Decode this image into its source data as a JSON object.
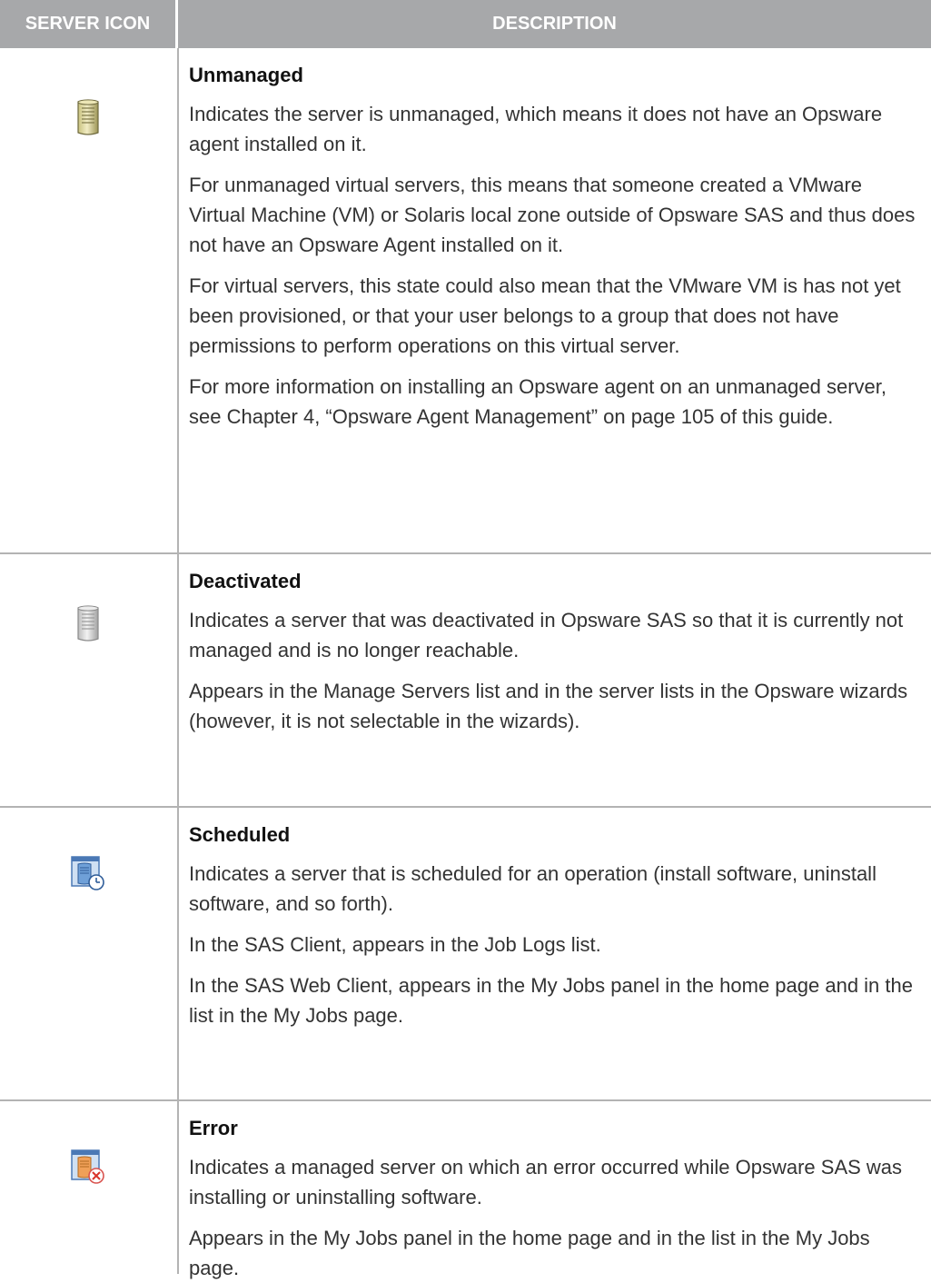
{
  "header": {
    "icon_col": "SERVER ICON",
    "desc_col": "DESCRIPTION"
  },
  "rows": [
    {
      "icon": "server-unmanaged-icon",
      "title": "Unmanaged",
      "paragraphs": [
        "Indicates the server is unmanaged, which means it does not have an Opsware agent installed on it.",
        "For unmanaged virtual servers, this means that someone created a VMware Virtual Machine (VM) or Solaris local zone outside of Opsware SAS and thus does not have an Opsware Agent installed on it.",
        "For virtual servers, this state could also mean that the VMware VM is has not yet been provisioned, or that your user belongs to a group that does not have permissions to perform operations on this virtual server.",
        "For more information on installing an Opsware agent on an unmanaged server, see Chapter 4, “Opsware Agent Management” on page 105 of this guide."
      ]
    },
    {
      "icon": "server-deactivated-icon",
      "title": "Deactivated",
      "paragraphs": [
        "Indicates a server that was deactivated in Opsware SAS so that it is currently not managed and is no longer reachable.",
        "Appears in the Manage Servers list and in the server lists in the Opsware wizards (however, it is not selectable in the wizards)."
      ]
    },
    {
      "icon": "server-scheduled-icon",
      "title": "Scheduled",
      "paragraphs": [
        "Indicates a server that is scheduled for an operation (install software, uninstall software, and so forth).",
        "In the SAS Client, appears in the Job Logs list.",
        "In the SAS Web Client, appears in the My Jobs panel in the home page and in the list in the My Jobs page."
      ]
    },
    {
      "icon": "server-error-icon",
      "title": "Error",
      "paragraphs": [
        "Indicates a managed server on which an error occurred while Opsware SAS was installing or uninstalling software.",
        "Appears in the My Jobs panel in the home page and in the list in the My Jobs page."
      ]
    }
  ]
}
